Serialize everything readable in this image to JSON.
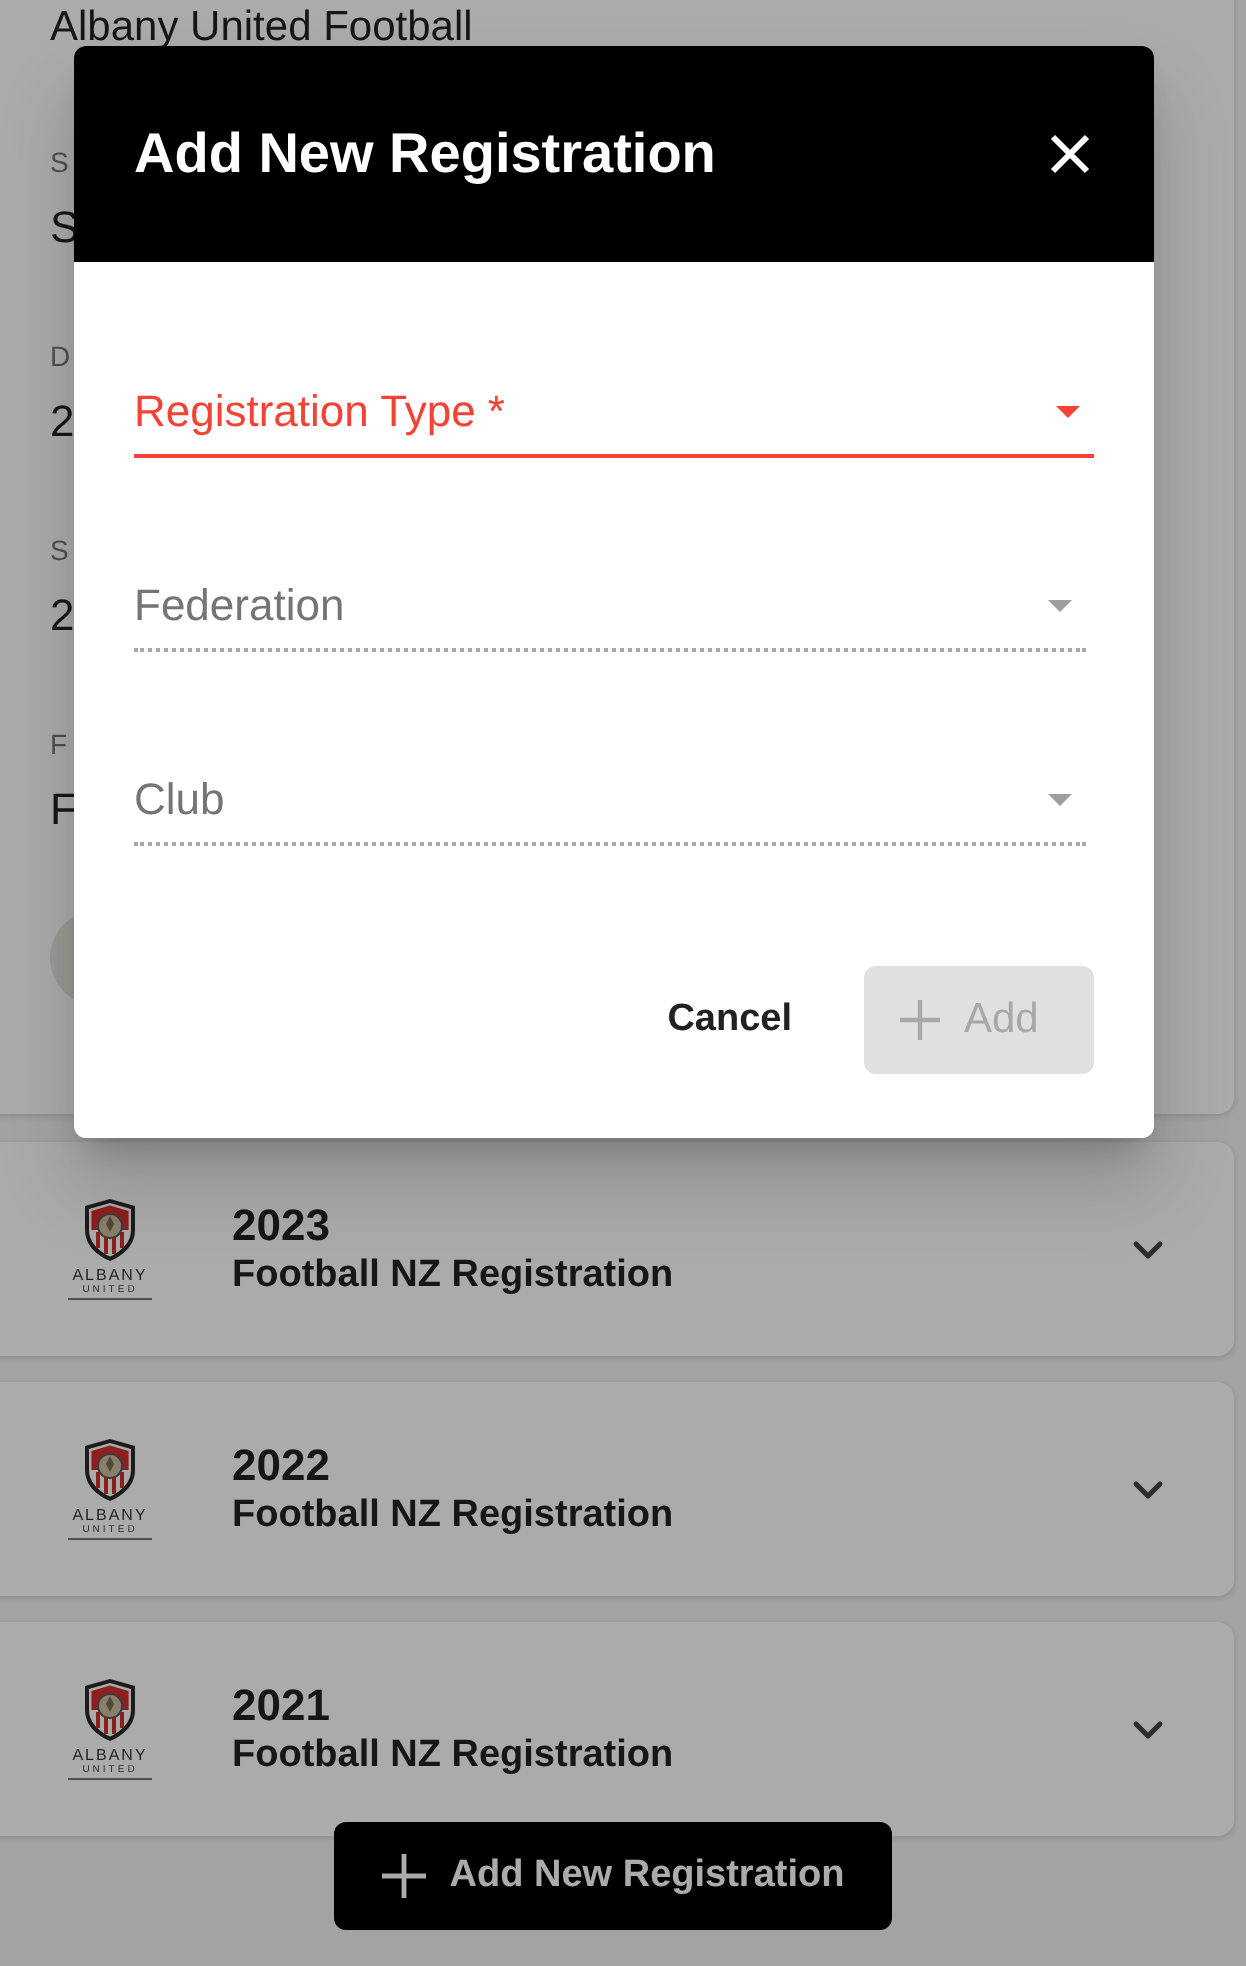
{
  "profile": {
    "name": "Albany United Football",
    "fields": [
      {
        "label": "S",
        "value": "S"
      },
      {
        "label": "D",
        "value": "2"
      },
      {
        "label": "S",
        "value": "2"
      },
      {
        "label": "F",
        "value": "F"
      }
    ]
  },
  "registrations": [
    {
      "year": "2023",
      "title": "Football NZ Registration",
      "logo": {
        "name": "ALBANY",
        "subtitle": "UNITED"
      },
      "expanded": false
    },
    {
      "year": "2022",
      "title": "Football NZ Registration",
      "logo": {
        "name": "ALBANY",
        "subtitle": "UNITED"
      },
      "expanded": false
    },
    {
      "year": "2021",
      "title": "Football NZ Registration",
      "logo": {
        "name": "ALBANY",
        "subtitle": "UNITED"
      },
      "expanded": false
    }
  ],
  "add_button": {
    "label": "Add New Registration"
  },
  "dialog": {
    "title": "Add New Registration",
    "fields": [
      {
        "label": "Registration Type *",
        "focused": true,
        "disabled": false
      },
      {
        "label": "Federation",
        "focused": false,
        "disabled": true
      },
      {
        "label": "Club",
        "focused": false,
        "disabled": true
      }
    ],
    "actions": [
      {
        "label": "Cancel",
        "kind": "text",
        "disabled": false
      },
      {
        "label": "Add",
        "kind": "contained",
        "disabled": true
      }
    ]
  }
}
